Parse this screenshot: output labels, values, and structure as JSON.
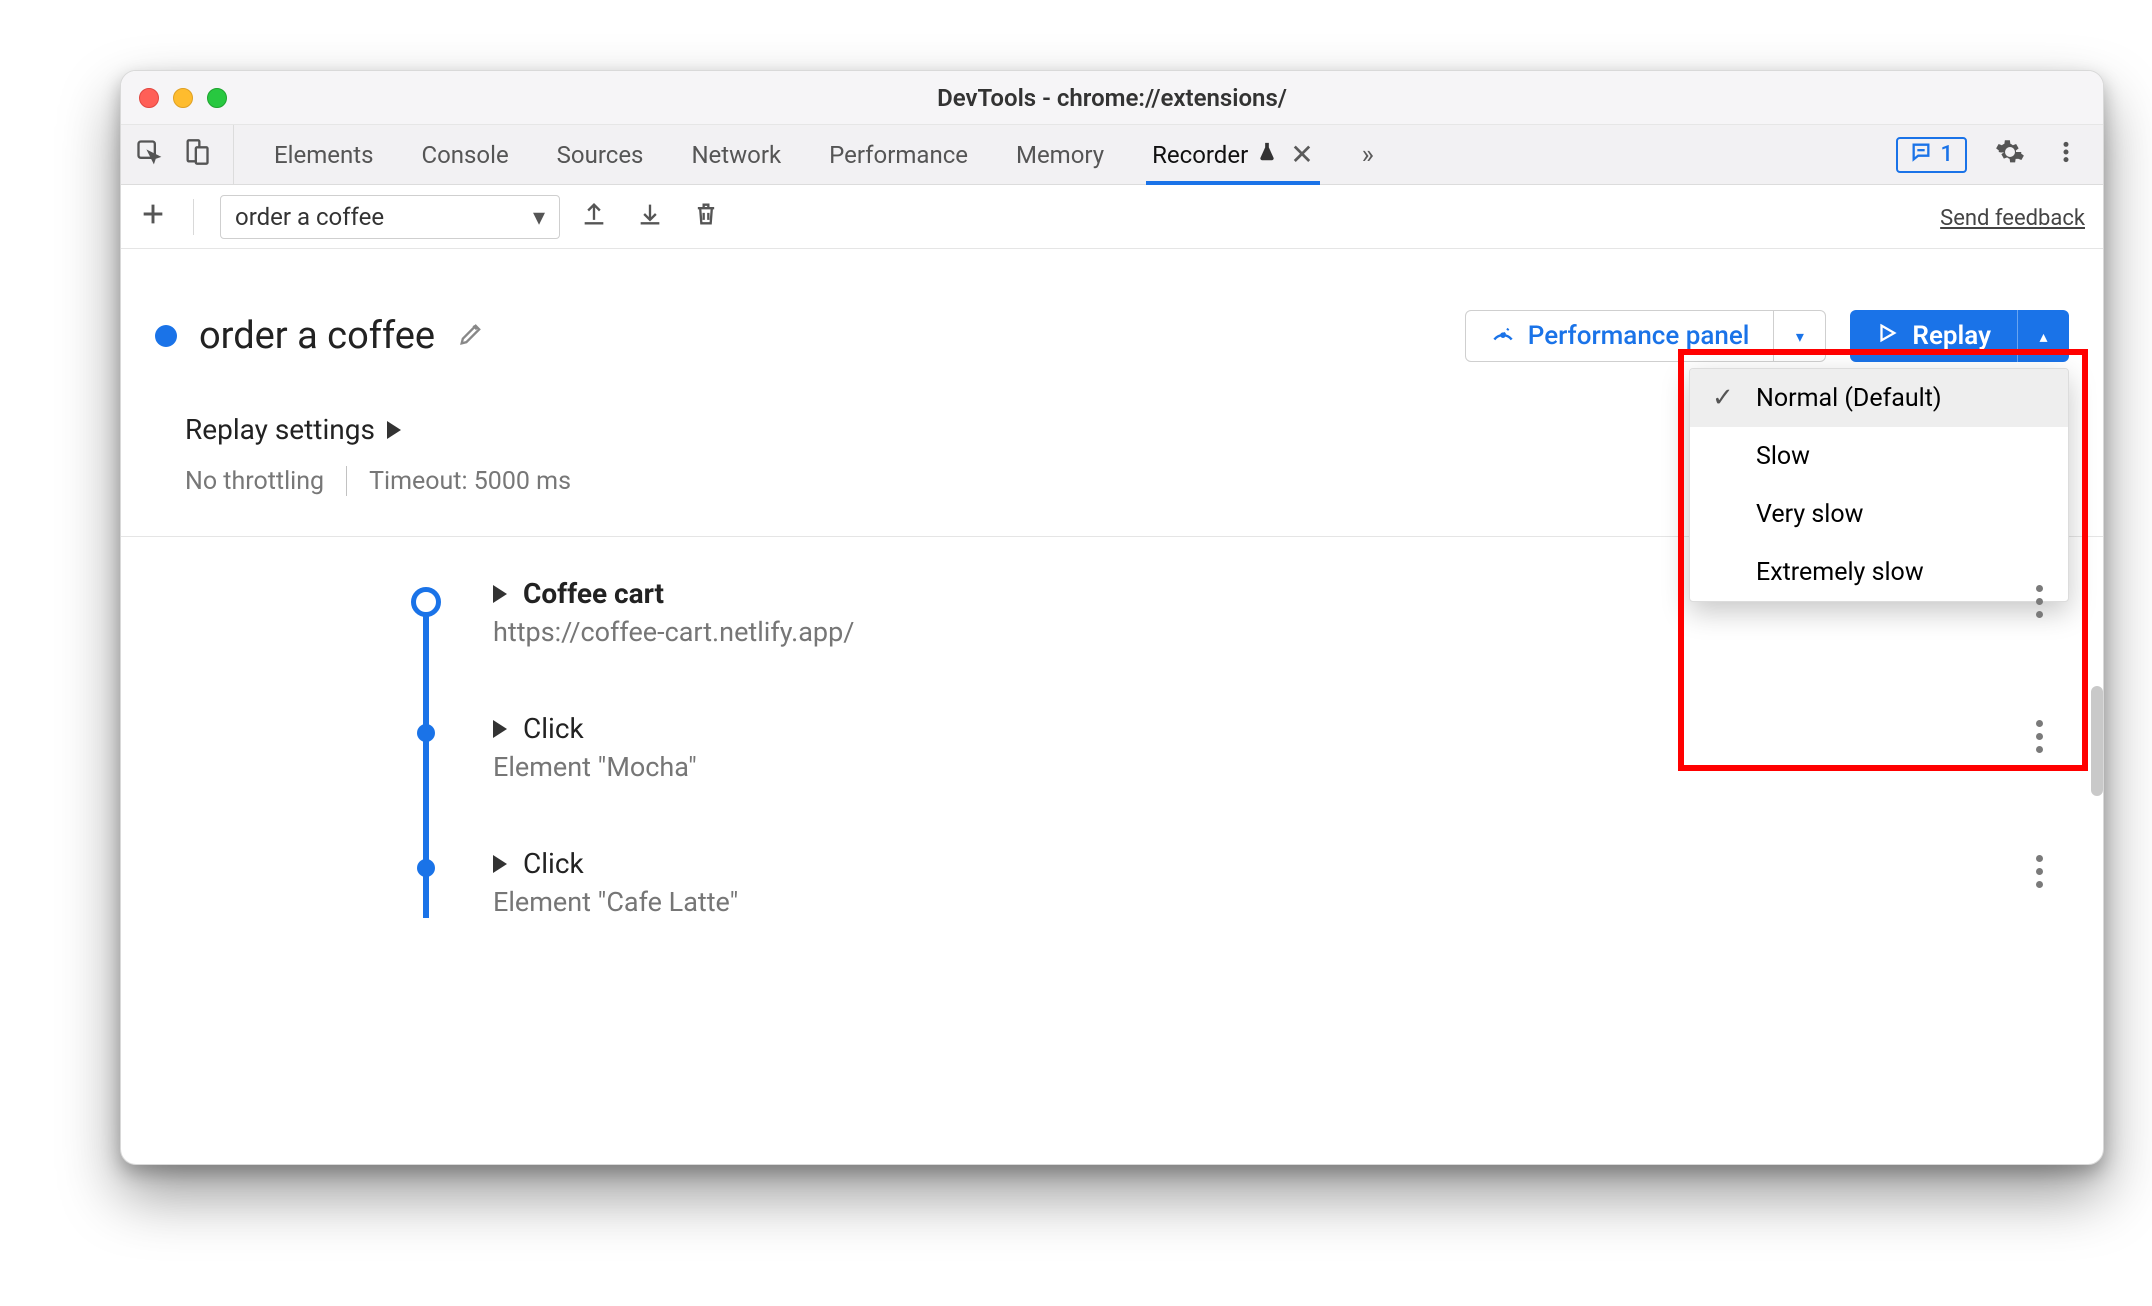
{
  "window": {
    "title": "DevTools - chrome://extensions/"
  },
  "tabs": {
    "items": [
      "Elements",
      "Console",
      "Sources",
      "Network",
      "Performance",
      "Memory"
    ],
    "active": {
      "label": "Recorder"
    },
    "messages_count": "1"
  },
  "toolbar": {
    "recording_name": "order a coffee",
    "send_feedback": "Send feedback"
  },
  "header": {
    "title": "order a coffee",
    "perf_label": "Performance panel",
    "replay_label": "Replay"
  },
  "replay_menu": {
    "items": [
      {
        "label": "Normal (Default)",
        "selected": true
      },
      {
        "label": "Slow",
        "selected": false
      },
      {
        "label": "Very slow",
        "selected": false
      },
      {
        "label": "Extremely slow",
        "selected": false
      }
    ]
  },
  "settings": {
    "title": "Replay settings",
    "throttling": "No throttling",
    "timeout": "Timeout: 5000 ms"
  },
  "steps": [
    {
      "title": "Coffee cart",
      "sub": "https://coffee-cart.netlify.app/",
      "start": true
    },
    {
      "title": "Click",
      "sub": "Element \"Mocha\"",
      "start": false
    },
    {
      "title": "Click",
      "sub": "Element \"Cafe Latte\"",
      "start": false
    }
  ]
}
